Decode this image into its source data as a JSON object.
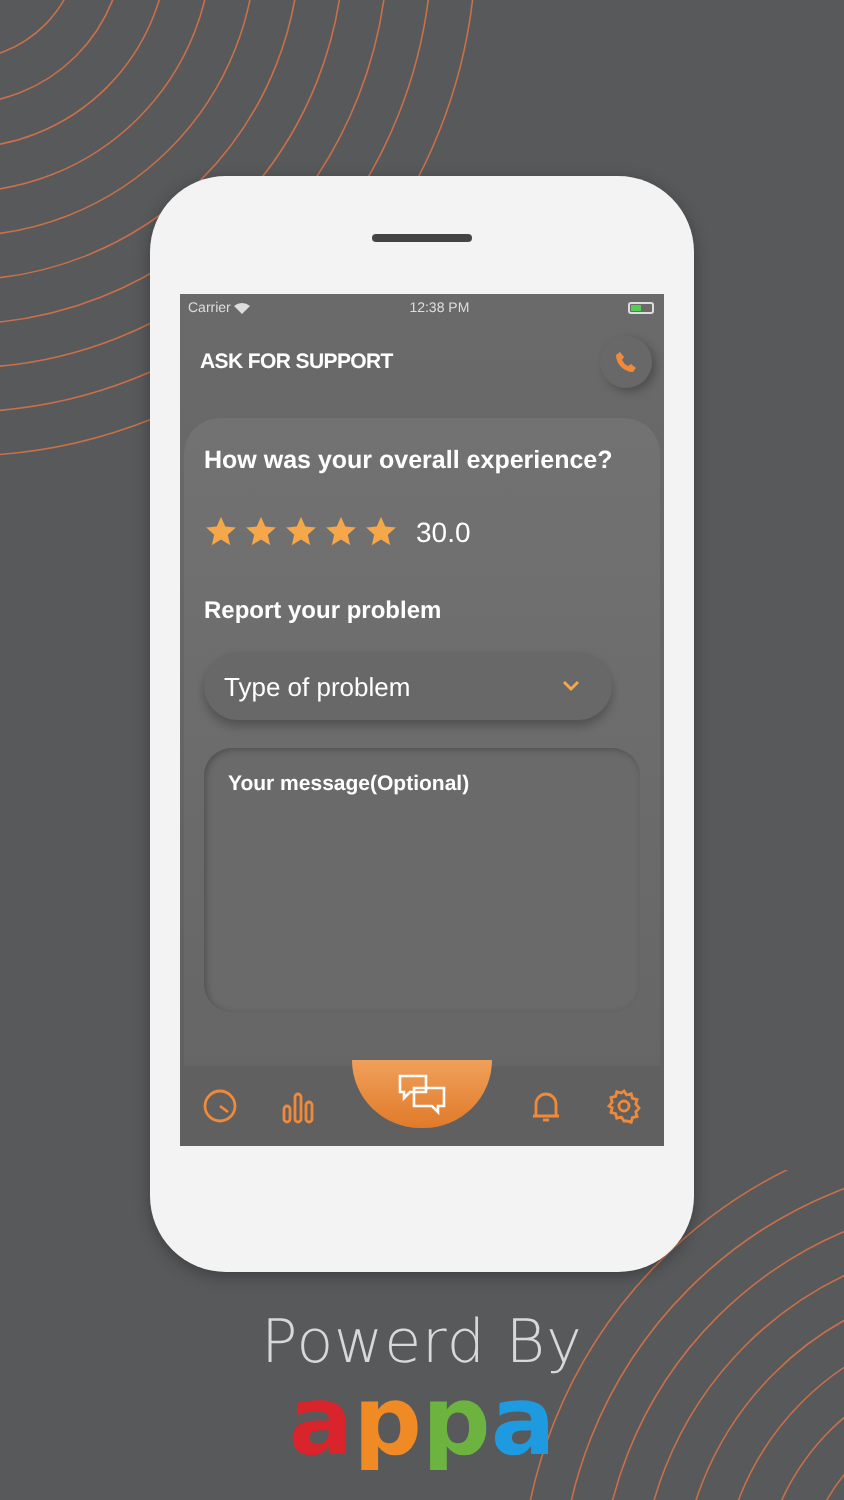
{
  "status_bar": {
    "carrier": "Carrier",
    "time": "12:38 PM"
  },
  "header": {
    "title": "ASK FOR SUPPORT"
  },
  "rating": {
    "question": "How was your overall experience?",
    "stars": 5,
    "score": "30.0"
  },
  "problem": {
    "heading": "Report your problem",
    "dropdown": {
      "placeholder": "Type of problem"
    },
    "message": {
      "placeholder": "Your message(Optional)"
    }
  },
  "nav": [
    {
      "kind": "gauge",
      "selected": false
    },
    {
      "kind": "chart",
      "selected": false
    },
    {
      "kind": "chat",
      "selected": true
    },
    {
      "kind": "bell",
      "selected": false
    },
    {
      "kind": "settings",
      "selected": false
    }
  ],
  "footer": {
    "caption": "Powerd By",
    "logo": "appa"
  }
}
